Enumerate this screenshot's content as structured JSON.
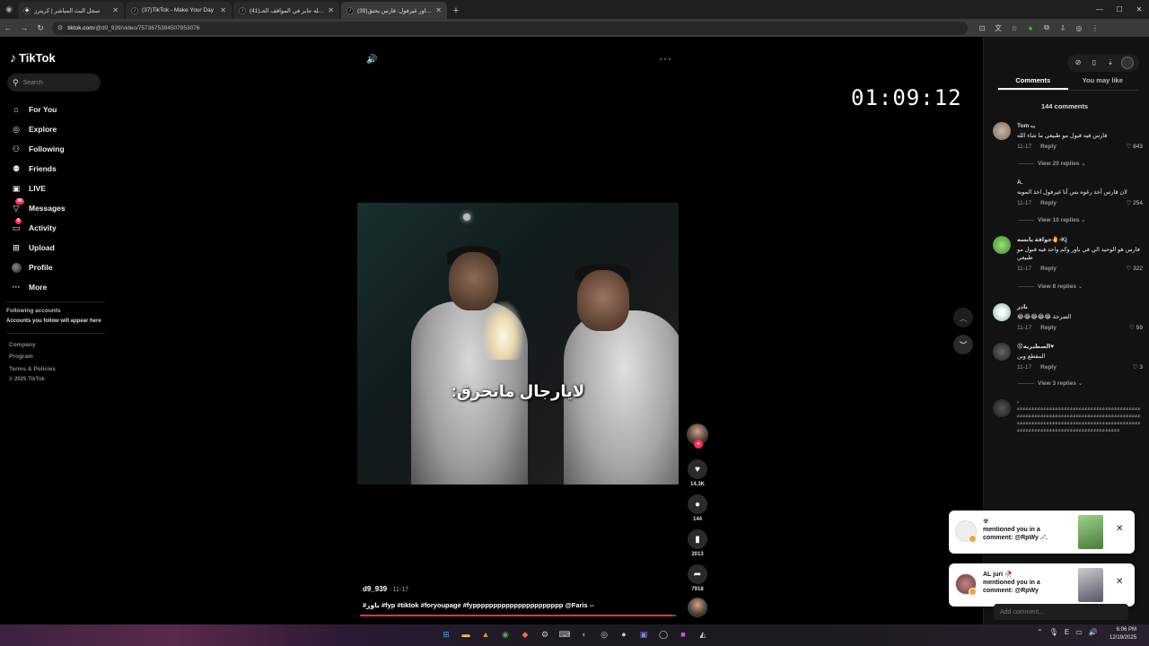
{
  "browser": {
    "tabs": [
      {
        "title": "سجل البث المباشر | كريترز",
        "active": false
      },
      {
        "title": "(37)TikTok - Make Your Day",
        "active": false
      },
      {
        "title": "(41)عبدالله جابر في المواقف الحـ...",
        "active": false
      },
      {
        "title": "(39)باور غيرفول: فارس يحتق...",
        "active": true
      }
    ],
    "url_host": "tiktok.com",
    "url_path": "/@d9_939/video/7573675394507853076"
  },
  "sidebar": {
    "logo": "TikTok",
    "search_placeholder": "Search",
    "items": [
      {
        "label": "For You",
        "icon": "home-icon"
      },
      {
        "label": "Explore",
        "icon": "compass-icon"
      },
      {
        "label": "Following",
        "icon": "following-icon"
      },
      {
        "label": "Friends",
        "icon": "friends-icon"
      },
      {
        "label": "LIVE",
        "icon": "live-icon"
      },
      {
        "label": "Messages",
        "icon": "messages-icon",
        "badge": "36"
      },
      {
        "label": "Activity",
        "icon": "activity-icon",
        "badge": "8"
      },
      {
        "label": "Upload",
        "icon": "upload-icon"
      },
      {
        "label": "Profile",
        "icon": "profile-icon"
      },
      {
        "label": "More",
        "icon": "more-icon"
      }
    ],
    "following_accounts_title": "Following accounts",
    "following_accounts_sub": "Accounts you follow will appear here",
    "footer": [
      "Company",
      "Program",
      "Terms & Policies",
      "© 2025 TikTok"
    ]
  },
  "video": {
    "timer": "01:09:12",
    "caption_overlay": "لايارجال ماتحرق:",
    "likes": "14.3K",
    "comments": "144",
    "saves": "2013",
    "shares": "7918",
    "author": "d9_939",
    "date": "11-17",
    "description": "#باور #fyp #tiktok #foryoupage #fypppppppppppppppppppppp @Faris --",
    "progress_fraction": 0.99
  },
  "comments_panel": {
    "tab_comments": "Comments",
    "tab_you_may_like": "You may like",
    "count_label": "144 comments",
    "add_comment_placeholder": "Add comment...",
    "comments": [
      {
        "user": "Tom ₛₐ",
        "text": "فارس فيه قبول مو طبيعي ما شاء الله",
        "date": "11-17",
        "reply": "Reply",
        "likes": "843",
        "replies": "View 20 replies"
      },
      {
        "user": "A.",
        "text": "لان فارس أخذ رغوه بس أنا غيرفول اخذ المويه",
        "date": "11-17",
        "reply": "Reply",
        "likes": "254",
        "replies": "View 10 replies"
      },
      {
        "user": "جوافة يابسه🤚-Kj",
        "text": "فارس هو الوحيد الي في باور وكم واحد فيه قبول مو طبيعي",
        "date": "11-17",
        "reply": "Reply",
        "likes": "322",
        "replies": "View 8 replies"
      },
      {
        "user": "نادر",
        "text": "الصرخة 😂😂😂😂😂",
        "date": "11-17",
        "reply": "Reply",
        "likes": "59",
        "replies": ""
      },
      {
        "user": "😡الصطيريه♥",
        "text": "المقطع وين",
        "date": "11-17",
        "reply": "Reply",
        "likes": "3",
        "replies": "View 3 replies"
      },
      {
        "user": "-",
        "text": "ﻋﻋﻋﻋﻋﻋﻋﻋﻋﻋﻋﻋﻋﻋﻋﻋﻋﻋﻋﻋﻋﻋﻋﻋﻋﻋﻋﻋﻋﻋﻋﻋﻋﻋﻋﻋﻋﻋﻋﻋﻋﻋﻋﻋﻋﻋﻋﻋﻋﻋﻋﻋﻋﻋﻋﻋﻋﻋﻋﻋﻋﻋﻋﻋﻋﻋﻋﻋﻋﻋﻋﻋﻋﻋﻋﻋﻋﻋﻋﻋﻋﻋﻋﻋﻋﻋﻋﻋﻋﻋﻋﻋﻋﻋﻋﻋﻋﻋﻋﻋﻋﻋﻋﻋﻋﻋﻋﻋﻋﻋﻋﻋﻋﻋﻋﻋﻋﻋﻋﻋﻋﻋﻋﻋﻋﻋﻋﻋﻋﻋﻋﻋﻋﻋﻋﻋﻋﻋﻋﻋﻋﻋﻋﻋﻋﻋﻋﻋﻋﻋﻋﻋﻋﻋﻋﻋﻋﻋﻋﻋﻋ",
        "date": "",
        "reply": "",
        "likes": "",
        "replies": ""
      }
    ]
  },
  "notifications": [
    {
      "user": "☢",
      "text_line1": "mentioned you in a",
      "text_line2": "comment: @RpWy .-'."
    },
    {
      "user": "AL juri 🥀",
      "text_line1": "mentioned you in a",
      "text_line2": "comment: @RpWy"
    }
  ],
  "taskbar": {
    "time": "6:06 PM",
    "date": "12/19/2025"
  },
  "colors": {
    "accent": "#fe2c55",
    "background": "#000000",
    "panel": "#121212"
  }
}
